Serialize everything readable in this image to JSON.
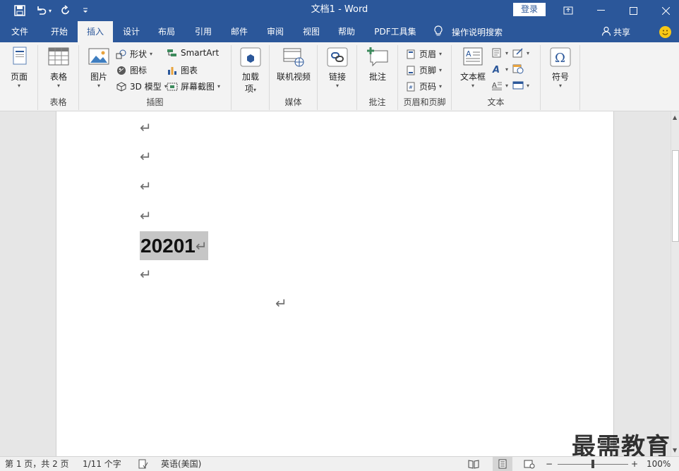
{
  "titlebar": {
    "title": "文档1  -  Word",
    "login": "登录",
    "qa_icons": [
      "save-icon",
      "undo-icon",
      "redo-icon",
      "customize-icon"
    ],
    "caret": "▾",
    "min": "—",
    "max": "☐",
    "close": "✕"
  },
  "tabs": [
    "文件",
    "开始",
    "插入",
    "设计",
    "布局",
    "引用",
    "邮件",
    "审阅",
    "视图",
    "帮助",
    "PDF工具集"
  ],
  "active_tab": "插入",
  "tell_me": "操作说明搜索",
  "share": "共享",
  "ribbon": {
    "pages": {
      "label": "页面"
    },
    "table": {
      "label": "表格",
      "group": "表格"
    },
    "illustrations": {
      "group": "插图",
      "picture": "图片",
      "shapes": "形状",
      "icons": "图标",
      "model3d": "3D 模型",
      "smartart": "SmartArt",
      "chart": "图表",
      "screenshot": "屏幕截图"
    },
    "addins": {
      "label1": "加载",
      "label2": "项"
    },
    "media": {
      "label": "联机视频",
      "group": "媒体"
    },
    "links": {
      "label": "链接"
    },
    "comments": {
      "label": "批注",
      "group": "批注"
    },
    "headerfooter": {
      "group": "页眉和页脚",
      "header": "页眉",
      "footer": "页脚",
      "pagenum": "页码"
    },
    "text": {
      "group": "文本",
      "textbox": "文本框"
    },
    "symbols": {
      "label": "符号"
    }
  },
  "document": {
    "para_mark": "↵",
    "selected_text": "20201"
  },
  "watermark": "最需教育",
  "status": {
    "page": "第 1 页，共 2 页",
    "words": "1/11 个字",
    "lang": "英语(美国)",
    "zoom": "100%",
    "zoom_minus": "−",
    "zoom_plus": "+"
  },
  "colors": {
    "brand": "#2b579a",
    "selection": "#c6c6c6",
    "ribbon_bg": "#f3f3f3"
  }
}
